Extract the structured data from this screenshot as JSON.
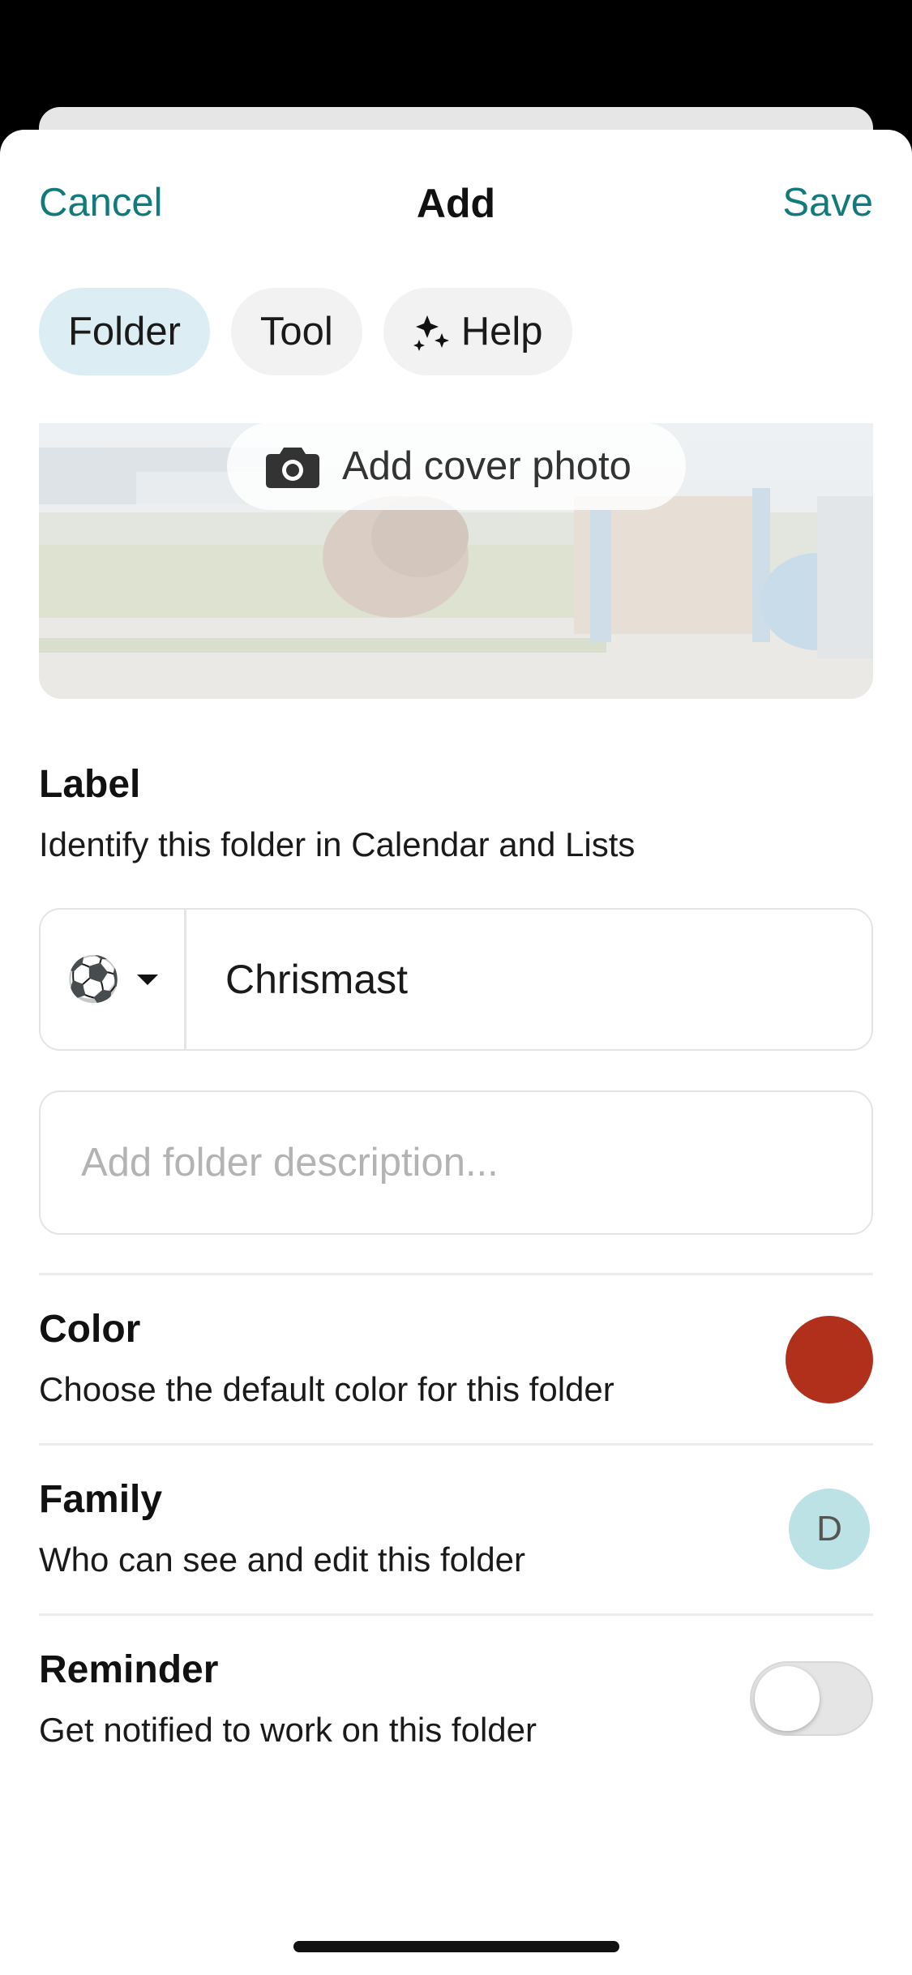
{
  "nav": {
    "cancel_label": "Cancel",
    "title": "Add",
    "save_label": "Save"
  },
  "tabs": [
    {
      "label": "Folder",
      "active": true
    },
    {
      "label": "Tool",
      "active": false
    },
    {
      "label": "Help",
      "active": false,
      "icon": "sparkle-icon"
    }
  ],
  "cover": {
    "button_label": "Add cover photo",
    "icon": "camera-icon"
  },
  "label_section": {
    "title": "Label",
    "subtitle": "Identify this folder in Calendar and Lists",
    "emoji": "⚽",
    "value": "Chrismast"
  },
  "description": {
    "value": "",
    "placeholder": "Add folder description..."
  },
  "color_section": {
    "title": "Color",
    "subtitle": "Choose the default color for this folder",
    "swatch_color": "#b0301c"
  },
  "family_section": {
    "title": "Family",
    "subtitle": "Who can see and edit this folder",
    "avatar_initial": "D",
    "avatar_color": "#bde2e6"
  },
  "reminder_section": {
    "title": "Reminder",
    "subtitle": "Get notified to work on this folder",
    "enabled": false
  },
  "colors": {
    "accent": "#127a7d",
    "active_tab_bg": "#dceef3"
  }
}
